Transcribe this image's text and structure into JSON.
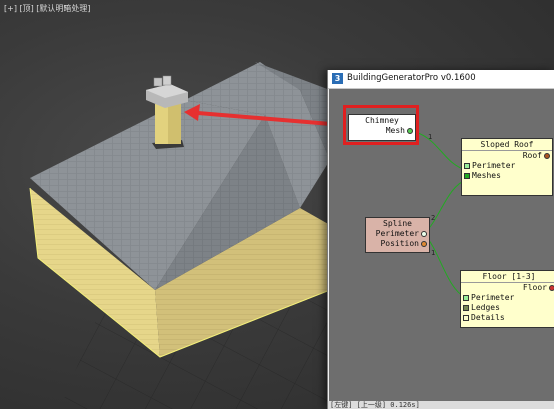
{
  "viewport": {
    "label": "[+] [顶] [默认明暗处理]",
    "filter_icon": "filter-icon"
  },
  "node_graph": {
    "title": "BuildingGeneratorPro v0.1600",
    "app_icon": "3",
    "nodes": {
      "chimney": {
        "title": "Chimney",
        "outputs": [
          "Mesh"
        ]
      },
      "sloped_roof": {
        "title": "Sloped Roof",
        "outputs": [
          "Roof"
        ],
        "inputs": [
          "Perimeter",
          "Meshes"
        ]
      },
      "spline": {
        "title": "Spline",
        "outputs": [
          "Perimeter",
          "Position"
        ]
      },
      "floor": {
        "title": "Floor [1-3]",
        "outputs": [
          "Floor"
        ],
        "inputs": [
          "Perimeter",
          "Ledges",
          "Details"
        ]
      }
    },
    "wire_labels": [
      "1",
      "2",
      "1"
    ],
    "status": "[左键] [上一级] 0.126s]"
  },
  "colors": {
    "highlight": "#e02020",
    "roof": "#8e9398",
    "wall": "#e8d98a",
    "port_green": "#55cc55",
    "port_brown": "#aa5522",
    "port_orange": "#dd8833"
  }
}
